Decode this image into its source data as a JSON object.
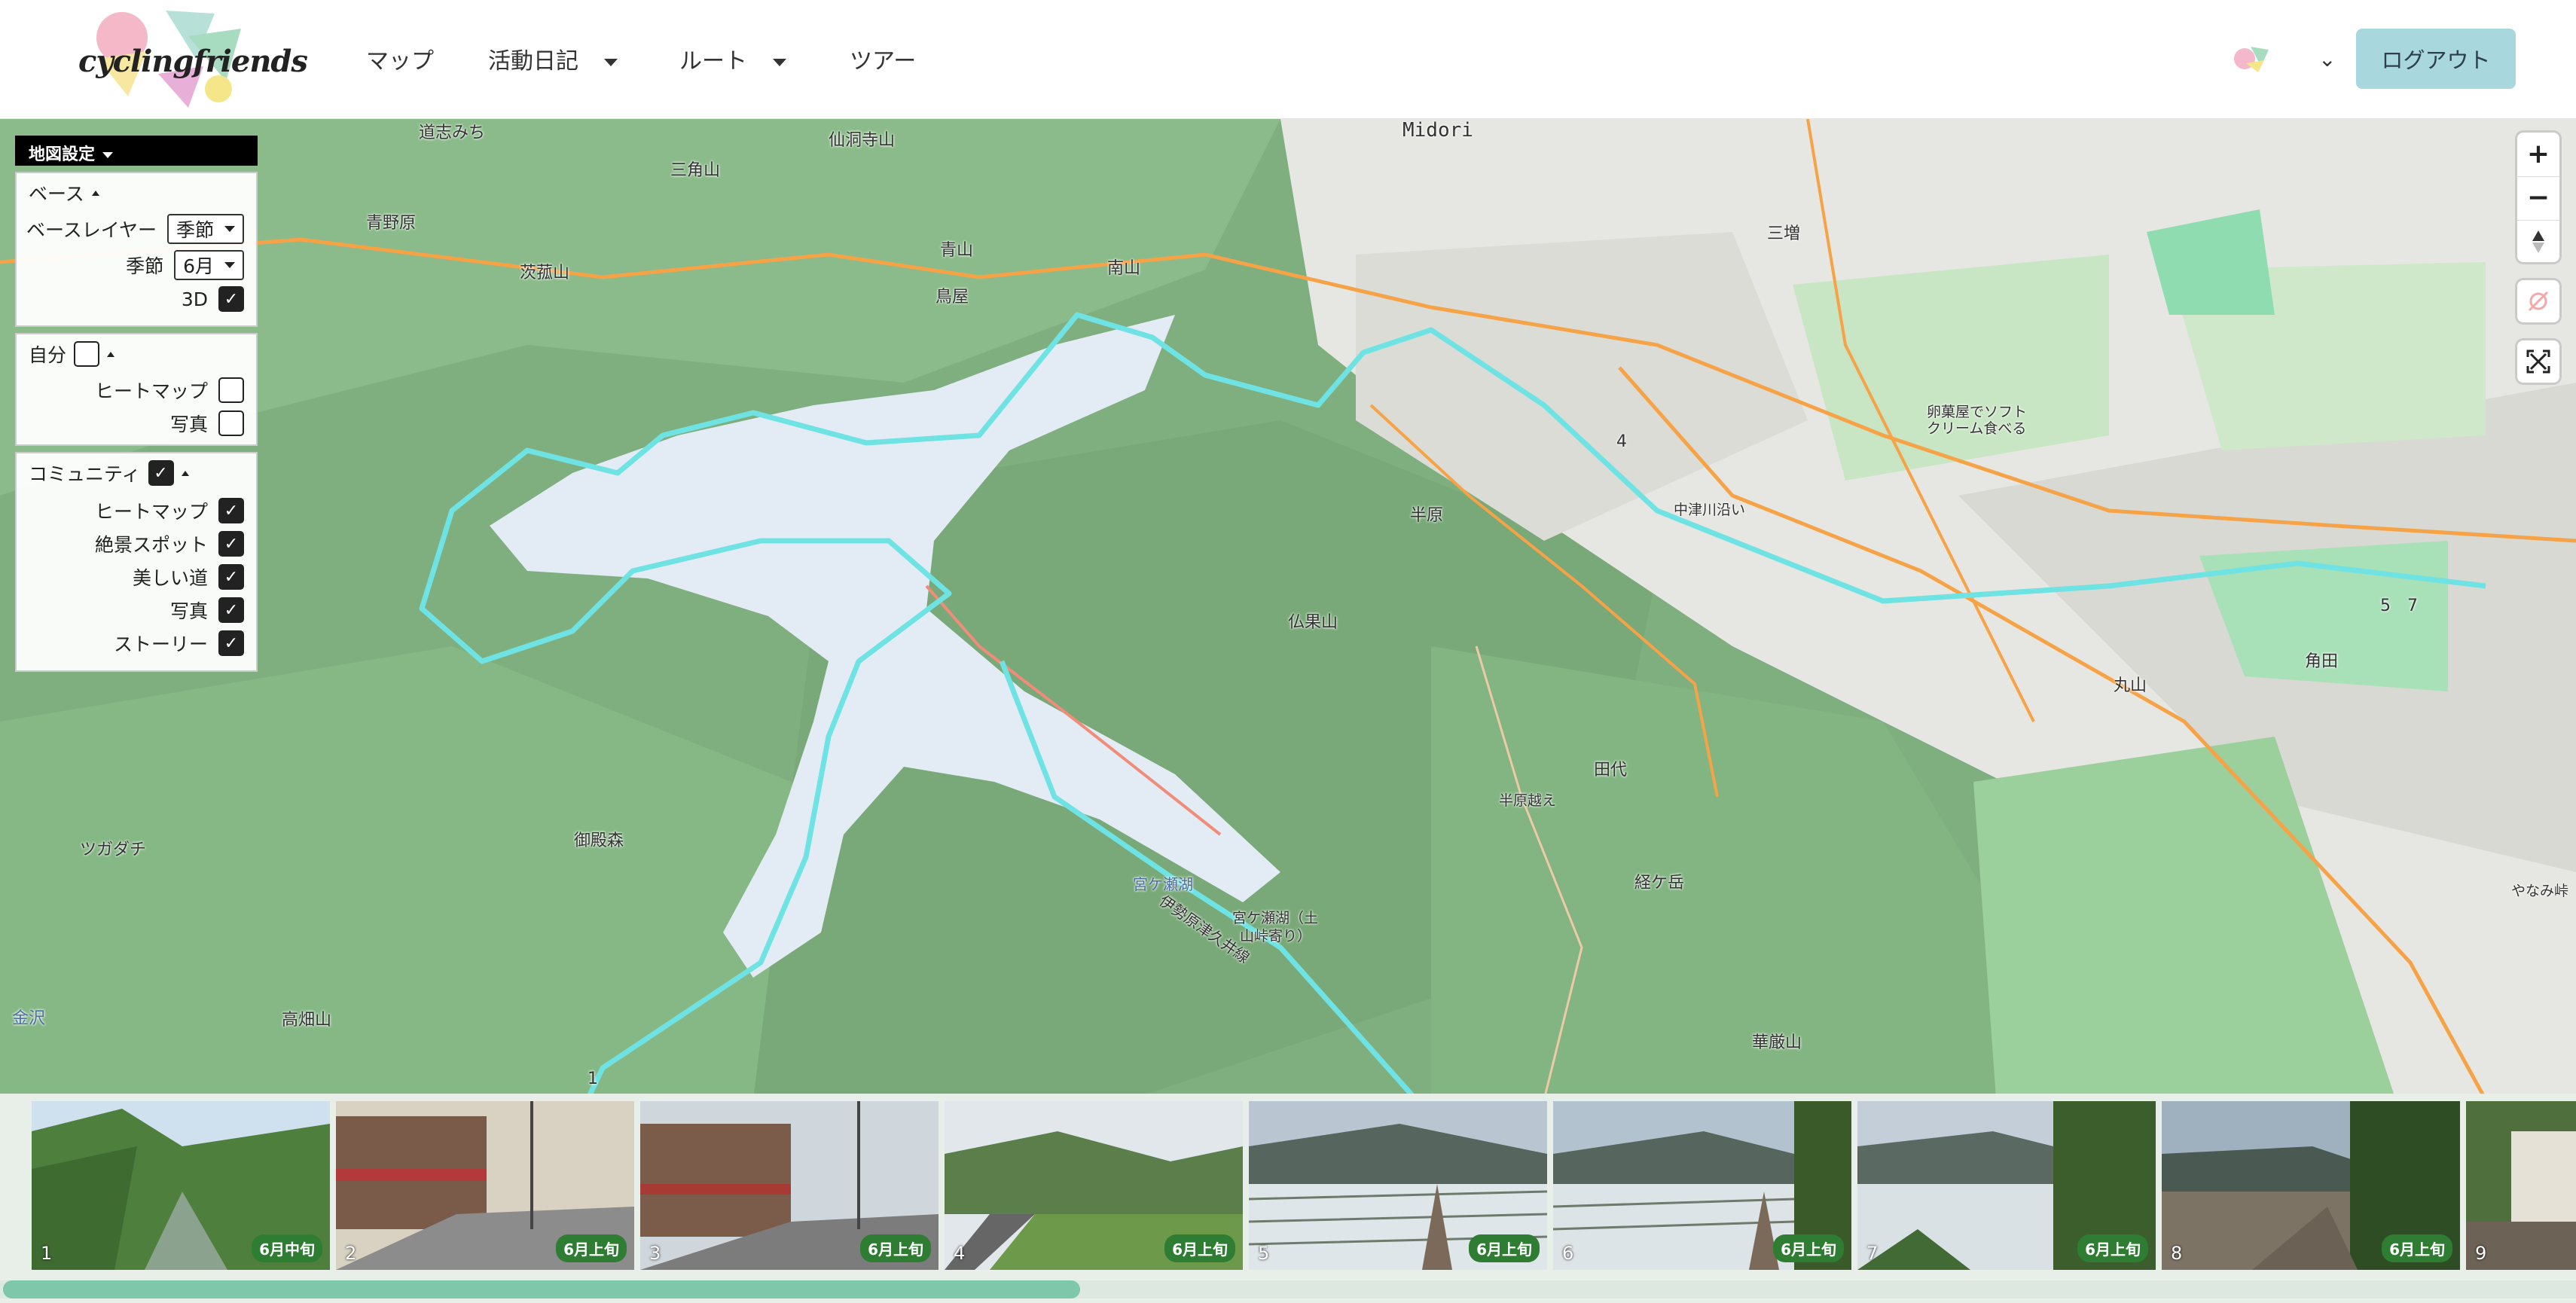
{
  "header": {
    "logo_text": "cyclingfriends",
    "nav": [
      {
        "label": "マップ",
        "has_dropdown": false
      },
      {
        "label": "活動日記",
        "has_dropdown": true
      },
      {
        "label": "ルート",
        "has_dropdown": true
      },
      {
        "label": "ツアー",
        "has_dropdown": false
      }
    ],
    "logout_label": "ログアウト",
    "chevron": "⌄"
  },
  "settings": {
    "title": "地図設定",
    "base": {
      "title": "ベース",
      "layer_label": "ベースレイヤー",
      "layer_value": "季節",
      "season_label": "季節",
      "season_value": "6月",
      "three_d_label": "3D",
      "three_d_checked": true
    },
    "self": {
      "title": "自分",
      "checked": false,
      "heatmap_label": "ヒートマップ",
      "heatmap_checked": false,
      "photo_label": "写真",
      "photo_checked": false
    },
    "community": {
      "title": "コミュニティ",
      "checked": true,
      "items": [
        {
          "label": "ヒートマップ",
          "checked": true
        },
        {
          "label": "絶景スポット",
          "checked": true
        },
        {
          "label": "美しい道",
          "checked": true
        },
        {
          "label": "写真",
          "checked": true
        },
        {
          "label": "ストーリー",
          "checked": true
        }
      ]
    }
  },
  "map": {
    "labels": {
      "l1": "道志みち",
      "l2": "仙洞寺山",
      "l3": "三角山",
      "l4": "Midori",
      "l5": "青野原",
      "l6": "茨菰山",
      "l7": "青山",
      "l8": "南山",
      "l9": "鳥屋",
      "l10": "三増",
      "l11": "卵菓屋でソフト",
      "l12": "クリーム食べる",
      "l13": "中津川沿い",
      "l14": "半原",
      "l15": "仏果山",
      "l16": "角田",
      "l17": "丸山",
      "l18": "田代",
      "l19": "半原越え",
      "l20": "経ケ岳",
      "l21": "ツガダチ",
      "l22": "御殿森",
      "l23": "伊勢原津久井線",
      "l24": "宮ケ瀬湖",
      "l25": "宮ケ瀬湖（土",
      "l26": "山峠寄り）",
      "l27": "高畑山",
      "l28": "華厳山",
      "l29": "金沢",
      "l30": "やなみ峠",
      "l31": "4",
      "l32": "5",
      "l33": "7",
      "l34": "1"
    },
    "zoom_in": "+",
    "zoom_out": "−"
  },
  "photos": [
    {
      "num": "1",
      "badge": "6月中旬"
    },
    {
      "num": "2",
      "badge": "6月上旬"
    },
    {
      "num": "3",
      "badge": "6月上旬"
    },
    {
      "num": "4",
      "badge": "6月上旬"
    },
    {
      "num": "5",
      "badge": "6月上旬"
    },
    {
      "num": "6",
      "badge": "6月上旬"
    },
    {
      "num": "7",
      "badge": "6月上旬"
    },
    {
      "num": "8",
      "badge": "6月上旬"
    },
    {
      "num": "9",
      "badge": ""
    }
  ],
  "colors": {
    "route": "#6fe3e3",
    "forest": "#7fb27f",
    "lake": "#e3ecf5",
    "logout_bg": "#a8d8de",
    "badge": "#2e7d32"
  }
}
